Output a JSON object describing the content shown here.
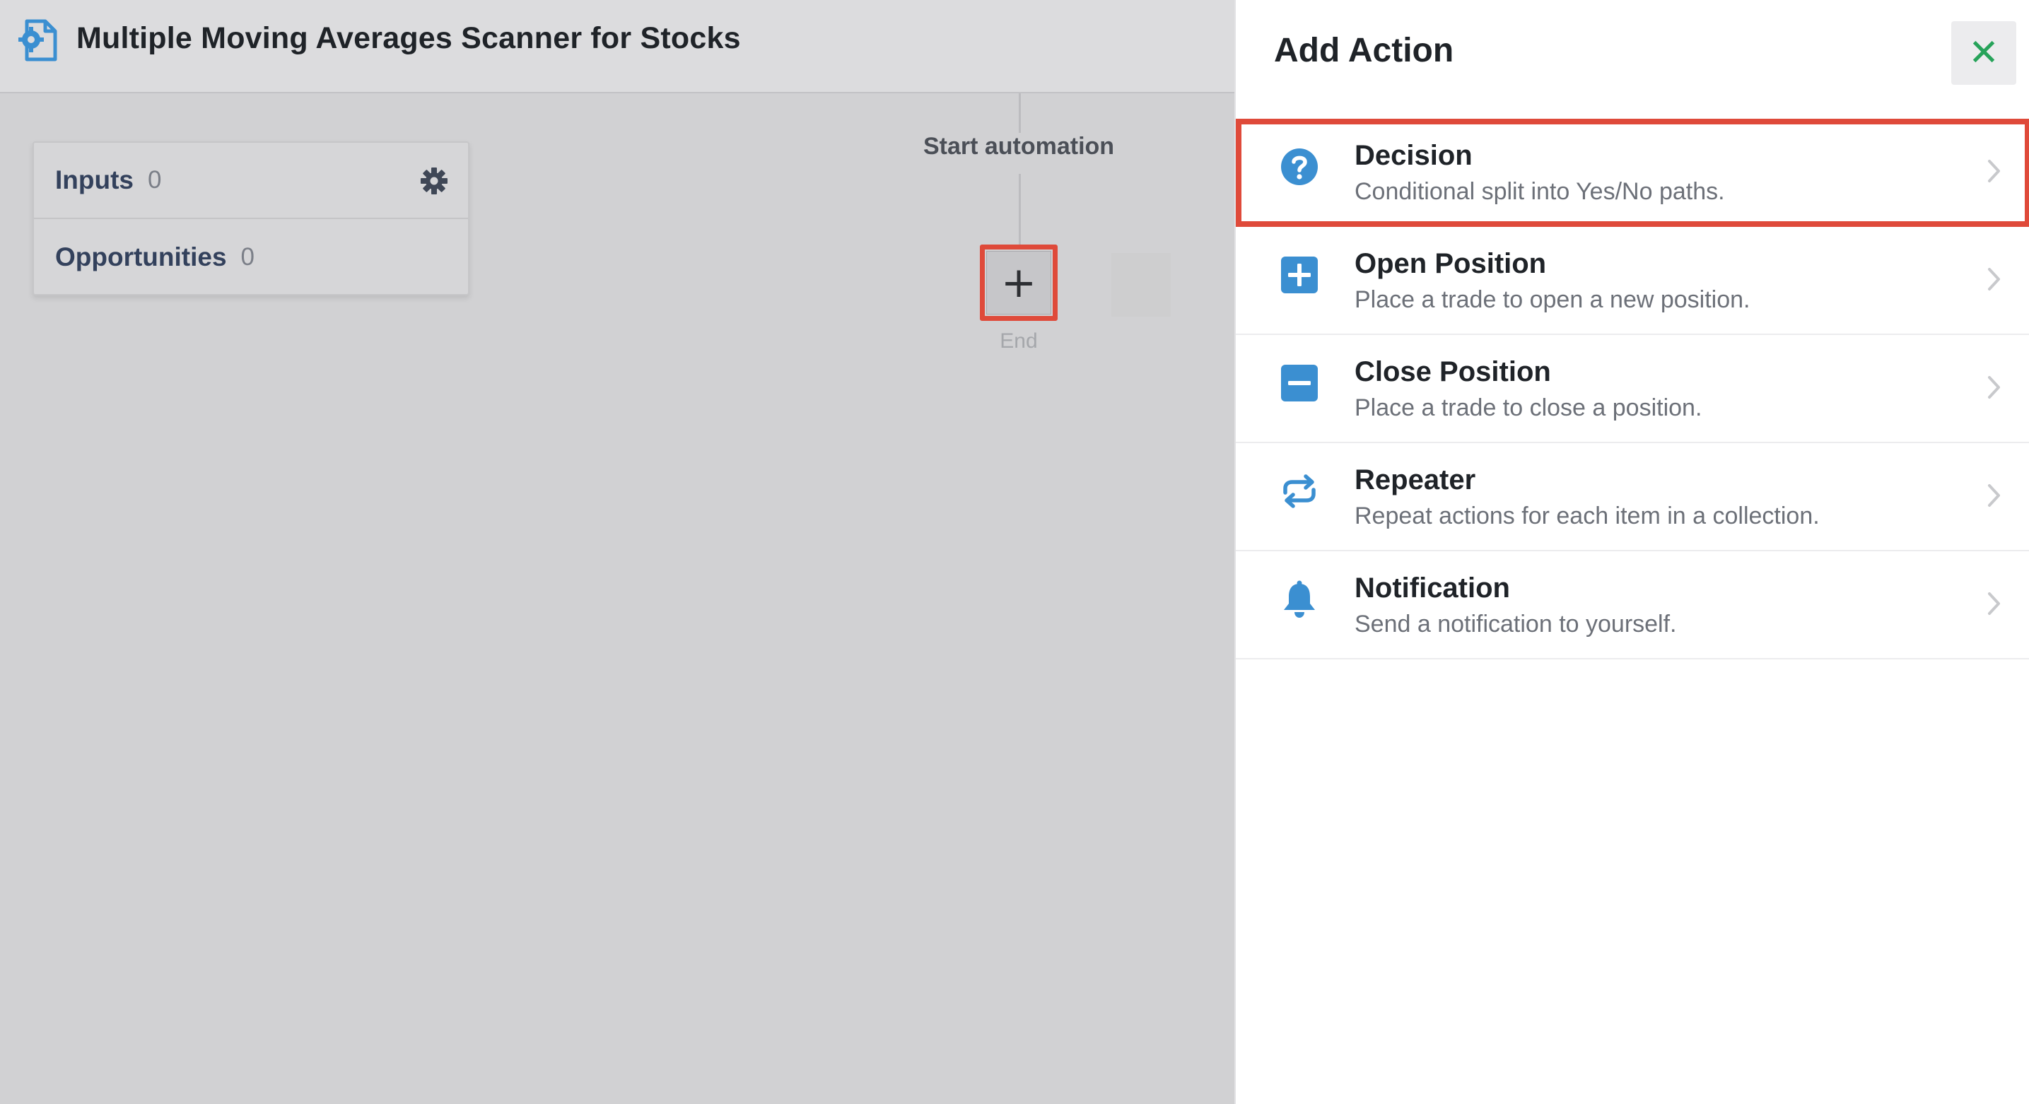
{
  "header": {
    "title": "Multiple Moving Averages Scanner for Stocks",
    "icon": "automation-gear-document-icon"
  },
  "sidebar_panel": {
    "rows": [
      {
        "label": "Inputs",
        "count": "0"
      },
      {
        "label": "Opportunities",
        "count": "0"
      }
    ]
  },
  "flow": {
    "start_label": "Start automation",
    "add_button_symbol": "+",
    "end_label": "End"
  },
  "drawer": {
    "title": "Add Action",
    "close_symbol": "✕",
    "actions": [
      {
        "name": "Decision",
        "description": "Conditional split into Yes/No paths.",
        "icon": "question-circle-icon",
        "selected": true
      },
      {
        "name": "Open Position",
        "description": "Place a trade to open a new position.",
        "icon": "plus-square-icon",
        "selected": false
      },
      {
        "name": "Close Position",
        "description": "Place a trade to close a position.",
        "icon": "minus-square-icon",
        "selected": false
      },
      {
        "name": "Repeater",
        "description": "Repeat actions for each item in a collection.",
        "icon": "repeat-arrows-icon",
        "selected": false
      },
      {
        "name": "Notification",
        "description": "Send a notification to yourself.",
        "icon": "bell-icon",
        "selected": false
      }
    ]
  },
  "colors": {
    "accent_blue": "#3b8fd1",
    "highlight_red": "#df4a3a",
    "close_green": "#27a35a"
  }
}
